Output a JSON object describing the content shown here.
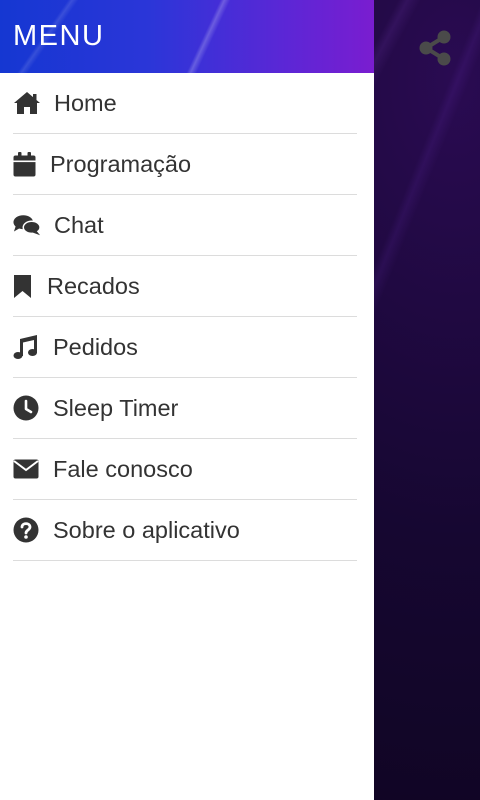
{
  "drawer": {
    "title": "MENU",
    "items": [
      {
        "label": "Home",
        "icon": "home-icon"
      },
      {
        "label": "Programação",
        "icon": "calendar-icon"
      },
      {
        "label": "Chat",
        "icon": "chat-bubbles-icon"
      },
      {
        "label": "Recados",
        "icon": "bookmark-icon"
      },
      {
        "label": "Pedidos",
        "icon": "music-note-icon"
      },
      {
        "label": "Sleep Timer",
        "icon": "clock-icon"
      },
      {
        "label": "Fale conosco",
        "icon": "envelope-icon"
      },
      {
        "label": "Sobre o aplicativo",
        "icon": "question-circle-icon"
      }
    ]
  },
  "app": {
    "share_icon": "share-icon"
  },
  "colors": {
    "header_start": "#1537d2",
    "header_end": "#7a1dd0",
    "text": "#333333",
    "divider": "#dcdcdc",
    "background": "#12051f"
  }
}
